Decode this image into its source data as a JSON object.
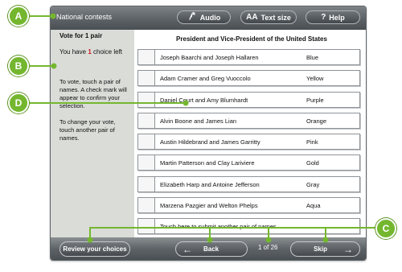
{
  "header": {
    "contest_name": "National contests",
    "audio_label": "Audio",
    "text_size_label": "Text size",
    "text_size_icon": "AA",
    "help_label": "Help",
    "help_icon": "?"
  },
  "sidebar": {
    "vote_for": "Vote for 1 pair",
    "you_have": "You have",
    "choices_left": "1",
    "choice_left_suffix": "choice left",
    "instructions": "To vote, touch a pair of names. A check mark will appear to confirm your selection.",
    "change_instructions": "To change your vote, touch another pair of names."
  },
  "contest": {
    "title": "President and Vice-President of the United States",
    "candidates": [
      {
        "name": "Joseph Baarchi and Joseph Hallaren",
        "party": "Blue"
      },
      {
        "name": "Adam Cramer and Greg Vuoccolo",
        "party": "Yellow"
      },
      {
        "name": "Daniel Court and Amy Blumhardt",
        "party": "Purple"
      },
      {
        "name": "Alvin Boone and James Lian",
        "party": "Orange"
      },
      {
        "name": "Austin Hildebrand and James Garritty",
        "party": "Pink"
      },
      {
        "name": "Martin Patterson and Clay Lariviere",
        "party": "Gold"
      },
      {
        "name": "Elizabeth Harp and Antoine Jefferson",
        "party": "Gray"
      },
      {
        "name": "Marzena Pazgier and Welton Phelps",
        "party": "Aqua"
      }
    ],
    "write_in_label": "Touch here to submit another pair of names"
  },
  "footer": {
    "review_label": "Review your choices",
    "back_label": "Back",
    "page_indicator": "1 of 26",
    "skip_label": "Skip"
  },
  "callouts": {
    "a": "A",
    "b": "B",
    "c": "C",
    "d": "D",
    "color": "#74b72f"
  }
}
